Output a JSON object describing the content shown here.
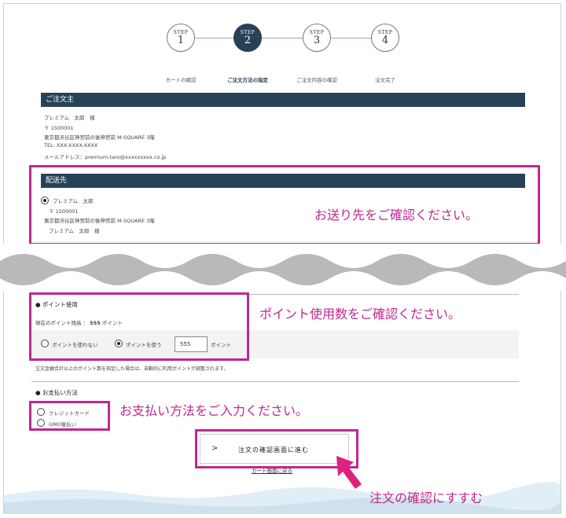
{
  "steps": [
    {
      "label": "STEP",
      "num": "1",
      "caption": "カートの確認"
    },
    {
      "label": "STEP",
      "num": "2",
      "caption": "ご注文方法の指定"
    },
    {
      "label": "STEP",
      "num": "3",
      "caption": "ご注文内容の確認"
    },
    {
      "label": "STEP",
      "num": "4",
      "caption": "注文完了"
    }
  ],
  "orderer": {
    "title": "ご注文主",
    "name": "プレミアム　太郎　様",
    "zip": "〒 1500001",
    "address": "東京都渋谷区神宮前の後神宮前 M-SQUARE 3階",
    "tel": "TEL: XXX-XXXX-XXXX",
    "email": "メールアドレス：premium-taro@xxxxxxxxx.co.jp"
  },
  "shipping": {
    "title": "配送先",
    "name": "プレミアム　太郎",
    "zip": "〒 1500001",
    "address": "東京都渋谷区神宮前の後神宮前 M-SQUARE 3階",
    "name2": "プレミアム　太郎　様",
    "callout": "お送り先をご確認ください。"
  },
  "points": {
    "title": "ポイント使用",
    "balance_label": "現在のポイント残高 ：",
    "balance_value": "555",
    "balance_unit": "ポイント",
    "opt_no": "ポイントを使わない",
    "opt_yes": "ポイントを使う",
    "input_value": "555",
    "input_unit": "ポイント",
    "note": "注文金額合計以上のポイント数を指定した場合は、自動的に利用ポイントが調整されます。",
    "callout": "ポイント使用数をご確認ください。"
  },
  "payment": {
    "title": "お支払い方法",
    "opt_credit": "クレジットカード",
    "opt_gmo": "GMO後払い",
    "callout": "お支払い方法をご入力ください。"
  },
  "actions": {
    "proceed": "注文の確認画面に進む",
    "proceed_chevron": ">",
    "back": "カート画面に戻る",
    "callout": "注文の確認にすすむ"
  },
  "colors": {
    "accent": "#274257",
    "highlight": "#c0288f"
  }
}
